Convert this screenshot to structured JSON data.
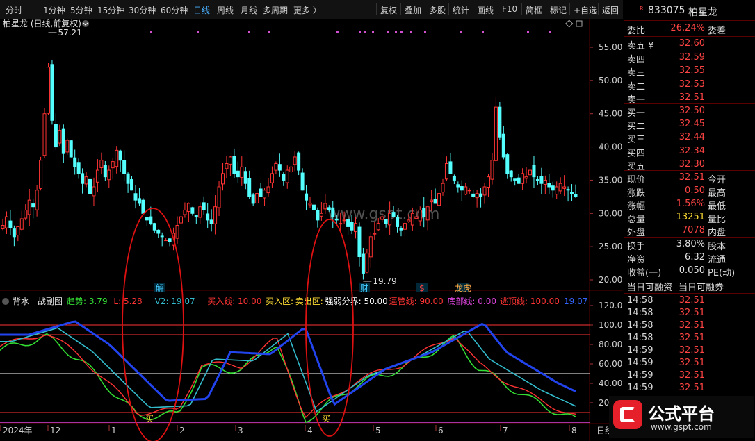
{
  "toolbar": {
    "left_items": [
      "分时",
      "1分钟",
      "5分钟",
      "15分钟",
      "30分钟",
      "60分钟",
      "日线",
      "周线",
      "月线",
      "多周期",
      "更多 〉"
    ],
    "active": "日线",
    "right_items": [
      "复权",
      "叠加",
      "多股",
      "统计",
      "画线",
      "F10",
      "简框",
      "标记",
      "+自选",
      "返回"
    ]
  },
  "main_chart": {
    "title": "柏星龙 (日线,前复权)",
    "high_label": "57.21",
    "low_label": "19.79",
    "watermark": "www.gspt.com",
    "price_ticks": [
      "55.00",
      "50.00",
      "45.00",
      "40.00",
      "35.00",
      "30.00",
      "25.00",
      "20.00"
    ],
    "event_markers": [
      "解",
      "财",
      "$",
      "龙虎"
    ]
  },
  "sub_chart": {
    "name": "背水一战副图",
    "indicators": [
      {
        "label": "趋势:",
        "value": "3.79",
        "color": "#33dd33"
      },
      {
        "label": "L:",
        "value": "5.28",
        "color": "#ff3333"
      },
      {
        "label": "V2:",
        "value": "19.07",
        "color": "#33bbcc"
      },
      {
        "label": "买入线:",
        "value": "10.00",
        "color": "#ff3333"
      },
      {
        "label": "买入区:",
        "value": "",
        "color": "#ffdd33"
      },
      {
        "label": "卖出区:",
        "value": "",
        "color": "#ffdd33"
      },
      {
        "label": "强弱分界:",
        "value": "50.00",
        "color": "#ffffff"
      },
      {
        "label": "逼管线:",
        "value": "90.00",
        "color": "#ff3333"
      },
      {
        "label": "底部线:",
        "value": "0.00",
        "color": "#dd44dd"
      },
      {
        "label": "逃顶线:",
        "value": "100.00",
        "color": "#ff3333"
      },
      {
        "label": "",
        "value": "19.07",
        "color": "#3366ff"
      }
    ],
    "ticks": [
      "120.0",
      "100.0",
      "80.00",
      "60.00",
      "40.00",
      "20.00"
    ],
    "buy_marks": [
      "买",
      "买"
    ]
  },
  "time_axis": {
    "labels": [
      "2024年",
      "12",
      "1",
      "2",
      "3",
      "4",
      "5",
      "6",
      "7",
      "8"
    ],
    "period_label": "日线"
  },
  "chart_data": {
    "type": "candlestick",
    "title": "柏星龙 (日线,前复权)",
    "ylim": [
      18.5,
      58
    ],
    "x_labels": [
      "2024年",
      "12",
      "1",
      "2",
      "3",
      "4",
      "5",
      "6",
      "7",
      "8"
    ],
    "closes": [
      28.2,
      29.5,
      27.8,
      26.5,
      28.0,
      29.2,
      30.5,
      32.0,
      31.0,
      33.5,
      38.0,
      45.0,
      52.0,
      44.0,
      40.0,
      42.5,
      39.0,
      41.0,
      38.5,
      37.0,
      36.0,
      34.5,
      35.5,
      33.0,
      34.0,
      36.5,
      38.0,
      35.5,
      36.5,
      37.8,
      39.5,
      38.0,
      36.0,
      34.5,
      33.5,
      32.0,
      31.5,
      30.0,
      29.0,
      28.5,
      27.5,
      27.0,
      26.5,
      26.0,
      25.8,
      27.0,
      28.2,
      29.5,
      30.5,
      31.5,
      30.0,
      29.5,
      31.0,
      30.5,
      29.0,
      28.5,
      31.0,
      34.0,
      36.0,
      37.5,
      38.5,
      36.0,
      35.5,
      37.0,
      34.5,
      32.5,
      31.5,
      33.0,
      32.5,
      33.5,
      34.0,
      36.0,
      37.5,
      36.5,
      35.0,
      36.5,
      37.0,
      38.5,
      36.5,
      33.5,
      32.0,
      31.5,
      30.5,
      29.0,
      30.0,
      31.5,
      30.5,
      29.5,
      29.0,
      28.5,
      29.0,
      28.0,
      27.5,
      28.5,
      23.5,
      21.0,
      24.0,
      26.5,
      27.0,
      28.5,
      29.5,
      28.5,
      30.0,
      29.5,
      28.0,
      27.5,
      28.5,
      29.0,
      30.0,
      29.5,
      30.5,
      29.5,
      31.0,
      32.0,
      31.5,
      33.0,
      34.5,
      37.5,
      36.0,
      35.0,
      34.0,
      33.5,
      34.0,
      33.5,
      32.5,
      33.0,
      32.5,
      34.0,
      35.5,
      38.0,
      46.0,
      41.5,
      38.5,
      36.0,
      35.5,
      35.0,
      34.5,
      36.0,
      35.5,
      36.5,
      35.5,
      35.0,
      34.5,
      35.0,
      34.0,
      33.5,
      34.0,
      34.5,
      34.0,
      33.5,
      33.0,
      32.51
    ],
    "sub_series": [
      {
        "name": "趋势",
        "color": "#33dd33"
      },
      {
        "name": "L",
        "color": "#ff3333"
      },
      {
        "name": "V2",
        "color": "#33bbcc"
      },
      {
        "name": "",
        "color": "#2244ee"
      }
    ]
  },
  "quote": {
    "header_code": "833075",
    "header_name": "柏星龙",
    "weibi_label": "委比",
    "weibi": "26.24%",
    "weicha_label": "委差",
    "sell_rows": [
      {
        "label": "卖五 ¥",
        "price": "32.60"
      },
      {
        "label": "卖四",
        "price": "32.59"
      },
      {
        "label": "卖三",
        "price": "32.55"
      },
      {
        "label": "卖二",
        "price": "32.53"
      },
      {
        "label": "卖一",
        "price": "32.51"
      }
    ],
    "buy_rows": [
      {
        "label": "买一",
        "price": "32.50"
      },
      {
        "label": "买二",
        "price": "32.45"
      },
      {
        "label": "买三",
        "price": "32.44"
      },
      {
        "label": "买四",
        "price": "32.34"
      },
      {
        "label": "买五",
        "price": "32.30"
      }
    ],
    "stats": [
      {
        "label": "现价",
        "value": "32.51",
        "color": "red",
        "label2": "今开"
      },
      {
        "label": "涨跌",
        "value": "0.50",
        "color": "red",
        "label2": "最高"
      },
      {
        "label": "涨幅",
        "value": "1.56%",
        "color": "red",
        "label2": "最低"
      },
      {
        "label": "总量",
        "value": "13251",
        "color": "yellow",
        "label2": "量比"
      },
      {
        "label": "外盘",
        "value": "7078",
        "color": "red",
        "label2": "内盘"
      }
    ],
    "stats2": [
      {
        "label": "换手",
        "value": "3.80%",
        "label2": "股本"
      },
      {
        "label": "净资",
        "value": "6.32",
        "label2": "流通"
      },
      {
        "label": "收益(一)",
        "value": "0.050",
        "label2": "PE(动)"
      }
    ],
    "margin_labels": [
      "当日可融资",
      "当日可融券"
    ],
    "ticks": [
      {
        "time": "14:58",
        "price": "32.51"
      },
      {
        "time": "14:58",
        "price": "32.51"
      },
      {
        "time": "14:58",
        "price": "32.51"
      },
      {
        "time": "14:58",
        "price": "32.51"
      },
      {
        "time": "14:59",
        "price": "32.51"
      },
      {
        "time": "14:59",
        "price": "32.51"
      },
      {
        "time": "14:59",
        "price": "32.51"
      },
      {
        "time": "14:59",
        "price": "32.51"
      },
      {
        "time": "14:59",
        "price": "32.51"
      }
    ]
  },
  "badge": {
    "title": "公式平台",
    "url": "www.gspt.com"
  }
}
